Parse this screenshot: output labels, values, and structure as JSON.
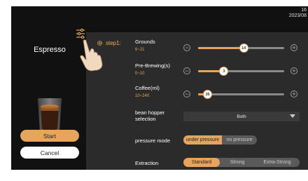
{
  "status": {
    "time": "16",
    "date": "2023/08"
  },
  "product": {
    "name": "Espresso"
  },
  "actions": {
    "start_label": "Start",
    "cancel_label": "Cancel"
  },
  "step": {
    "label": "step1:"
  },
  "params": {
    "grounds": {
      "label": "Grounds",
      "range": "6~21",
      "value": "14",
      "level": 0.53
    },
    "prebrewing": {
      "label": "Pre-Brewing(s)",
      "range": "0~10",
      "value": "3",
      "level": 0.3
    },
    "coffee": {
      "label": "Coffee(ml)",
      "range": "10~240",
      "value": "35",
      "level": 0.11
    }
  },
  "hopper": {
    "label_line1": "bean hopper",
    "label_line2": "selection",
    "selected": "Both"
  },
  "pressure": {
    "label": "pressure mode",
    "on_label": "under pressure",
    "off_label": "no pressure",
    "selected": "under pressure"
  },
  "extraction": {
    "label": "Extraction",
    "options": [
      "Standard",
      "Strong",
      "Extra-Strong"
    ],
    "selected": "Standard"
  },
  "colors": {
    "accent": "#e7a55b",
    "panel": "#2b2b2b",
    "background": "#111111"
  },
  "icons": {
    "settings": "sliders-icon",
    "hand": "hand-pointer-icon",
    "step": "gear-icon",
    "decrease": "minus-circle-icon",
    "increase": "plus-circle-icon"
  }
}
